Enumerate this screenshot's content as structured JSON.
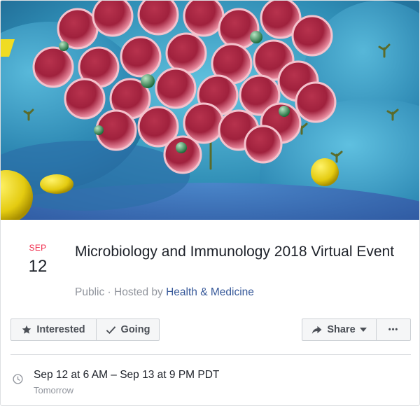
{
  "event": {
    "month": "SEP",
    "day": "12",
    "title": "Microbiology and Immunology 2018 Virtual Event",
    "privacy": "Public",
    "hosted_by_prefix": "Hosted by",
    "host": "Health & Medicine"
  },
  "actions": {
    "interested_label": "Interested",
    "going_label": "Going",
    "share_label": "Share",
    "more_label": "•••"
  },
  "time": {
    "range": "Sep 12 at 6 AM – Sep 13 at 9 PM PDT",
    "relative": "Tomorrow"
  },
  "icons": {
    "interested": "star-icon",
    "going": "checkmark-icon",
    "share": "share-arrow-icon",
    "share_menu": "caret-down-icon",
    "time": "clock-icon"
  },
  "colors": {
    "month_accent": "#f02849",
    "link": "#365899",
    "muted_text": "#90949c",
    "button_bg": "#f5f6f7"
  }
}
